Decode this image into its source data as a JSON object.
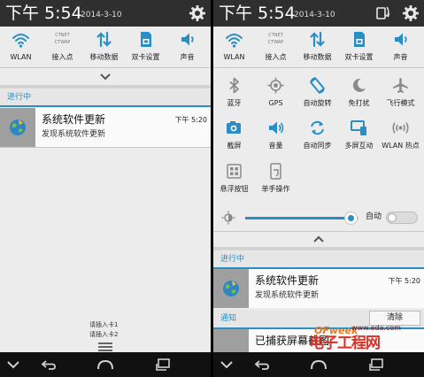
{
  "status_bar": {
    "time": "下午 5:54",
    "date": "2014-3-10"
  },
  "quick_tiles": [
    {
      "icon": "wifi-icon",
      "label": "WLAN"
    },
    {
      "icon": "access-point-icon",
      "label": "接入点",
      "sub_label_1": "CTNET",
      "sub_label_2": "CTWAP"
    },
    {
      "icon": "mobile-data-icon",
      "label": "移动数据"
    },
    {
      "icon": "dual-sim-icon",
      "label": "双卡设置"
    },
    {
      "icon": "sound-icon",
      "label": "声音"
    }
  ],
  "expanded_tiles": [
    {
      "icon": "bluetooth-icon",
      "label": "蓝牙"
    },
    {
      "icon": "gps-icon",
      "label": "GPS"
    },
    {
      "icon": "auto-rotate-icon",
      "label": "自动旋转"
    },
    {
      "icon": "do-not-disturb-icon",
      "label": "免打扰"
    },
    {
      "icon": "airplane-icon",
      "label": "飞行模式"
    },
    {
      "icon": "screenshot-icon",
      "label": "截屏"
    },
    {
      "icon": "volume-icon",
      "label": "音量"
    },
    {
      "icon": "auto-sync-icon",
      "label": "自动同步"
    },
    {
      "icon": "multi-screen-icon",
      "label": "多屏互动"
    },
    {
      "icon": "wlan-hotspot-icon",
      "label": "WLAN 热点"
    },
    {
      "icon": "floating-button-icon",
      "label": "悬浮按钮"
    },
    {
      "icon": "one-hand-icon",
      "label": "单手操作"
    }
  ],
  "brightness": {
    "auto_label": "自动",
    "level": 0.93
  },
  "ongoing_section": {
    "label": "进行中"
  },
  "notify_section": {
    "label": "通知",
    "clear_label": "清除"
  },
  "notification": {
    "title": "系统软件更新",
    "subtitle": "发现系统软件更新",
    "time": "下午 5:20"
  },
  "sim_notice": [
    "请插入卡1",
    "请插入卡2"
  ],
  "bottom_partial_title": "已捕获屏幕截图",
  "watermark": {
    "brand": "OFweek",
    "site_name": "电子工程网",
    "url": "www.eda.com",
    "colors": {
      "brand": "#e67817",
      "site": "#d93127"
    }
  },
  "colors": {
    "accent": "#2a8ec6",
    "statusbar": "#2f2f2f",
    "panel": "#ececec"
  }
}
